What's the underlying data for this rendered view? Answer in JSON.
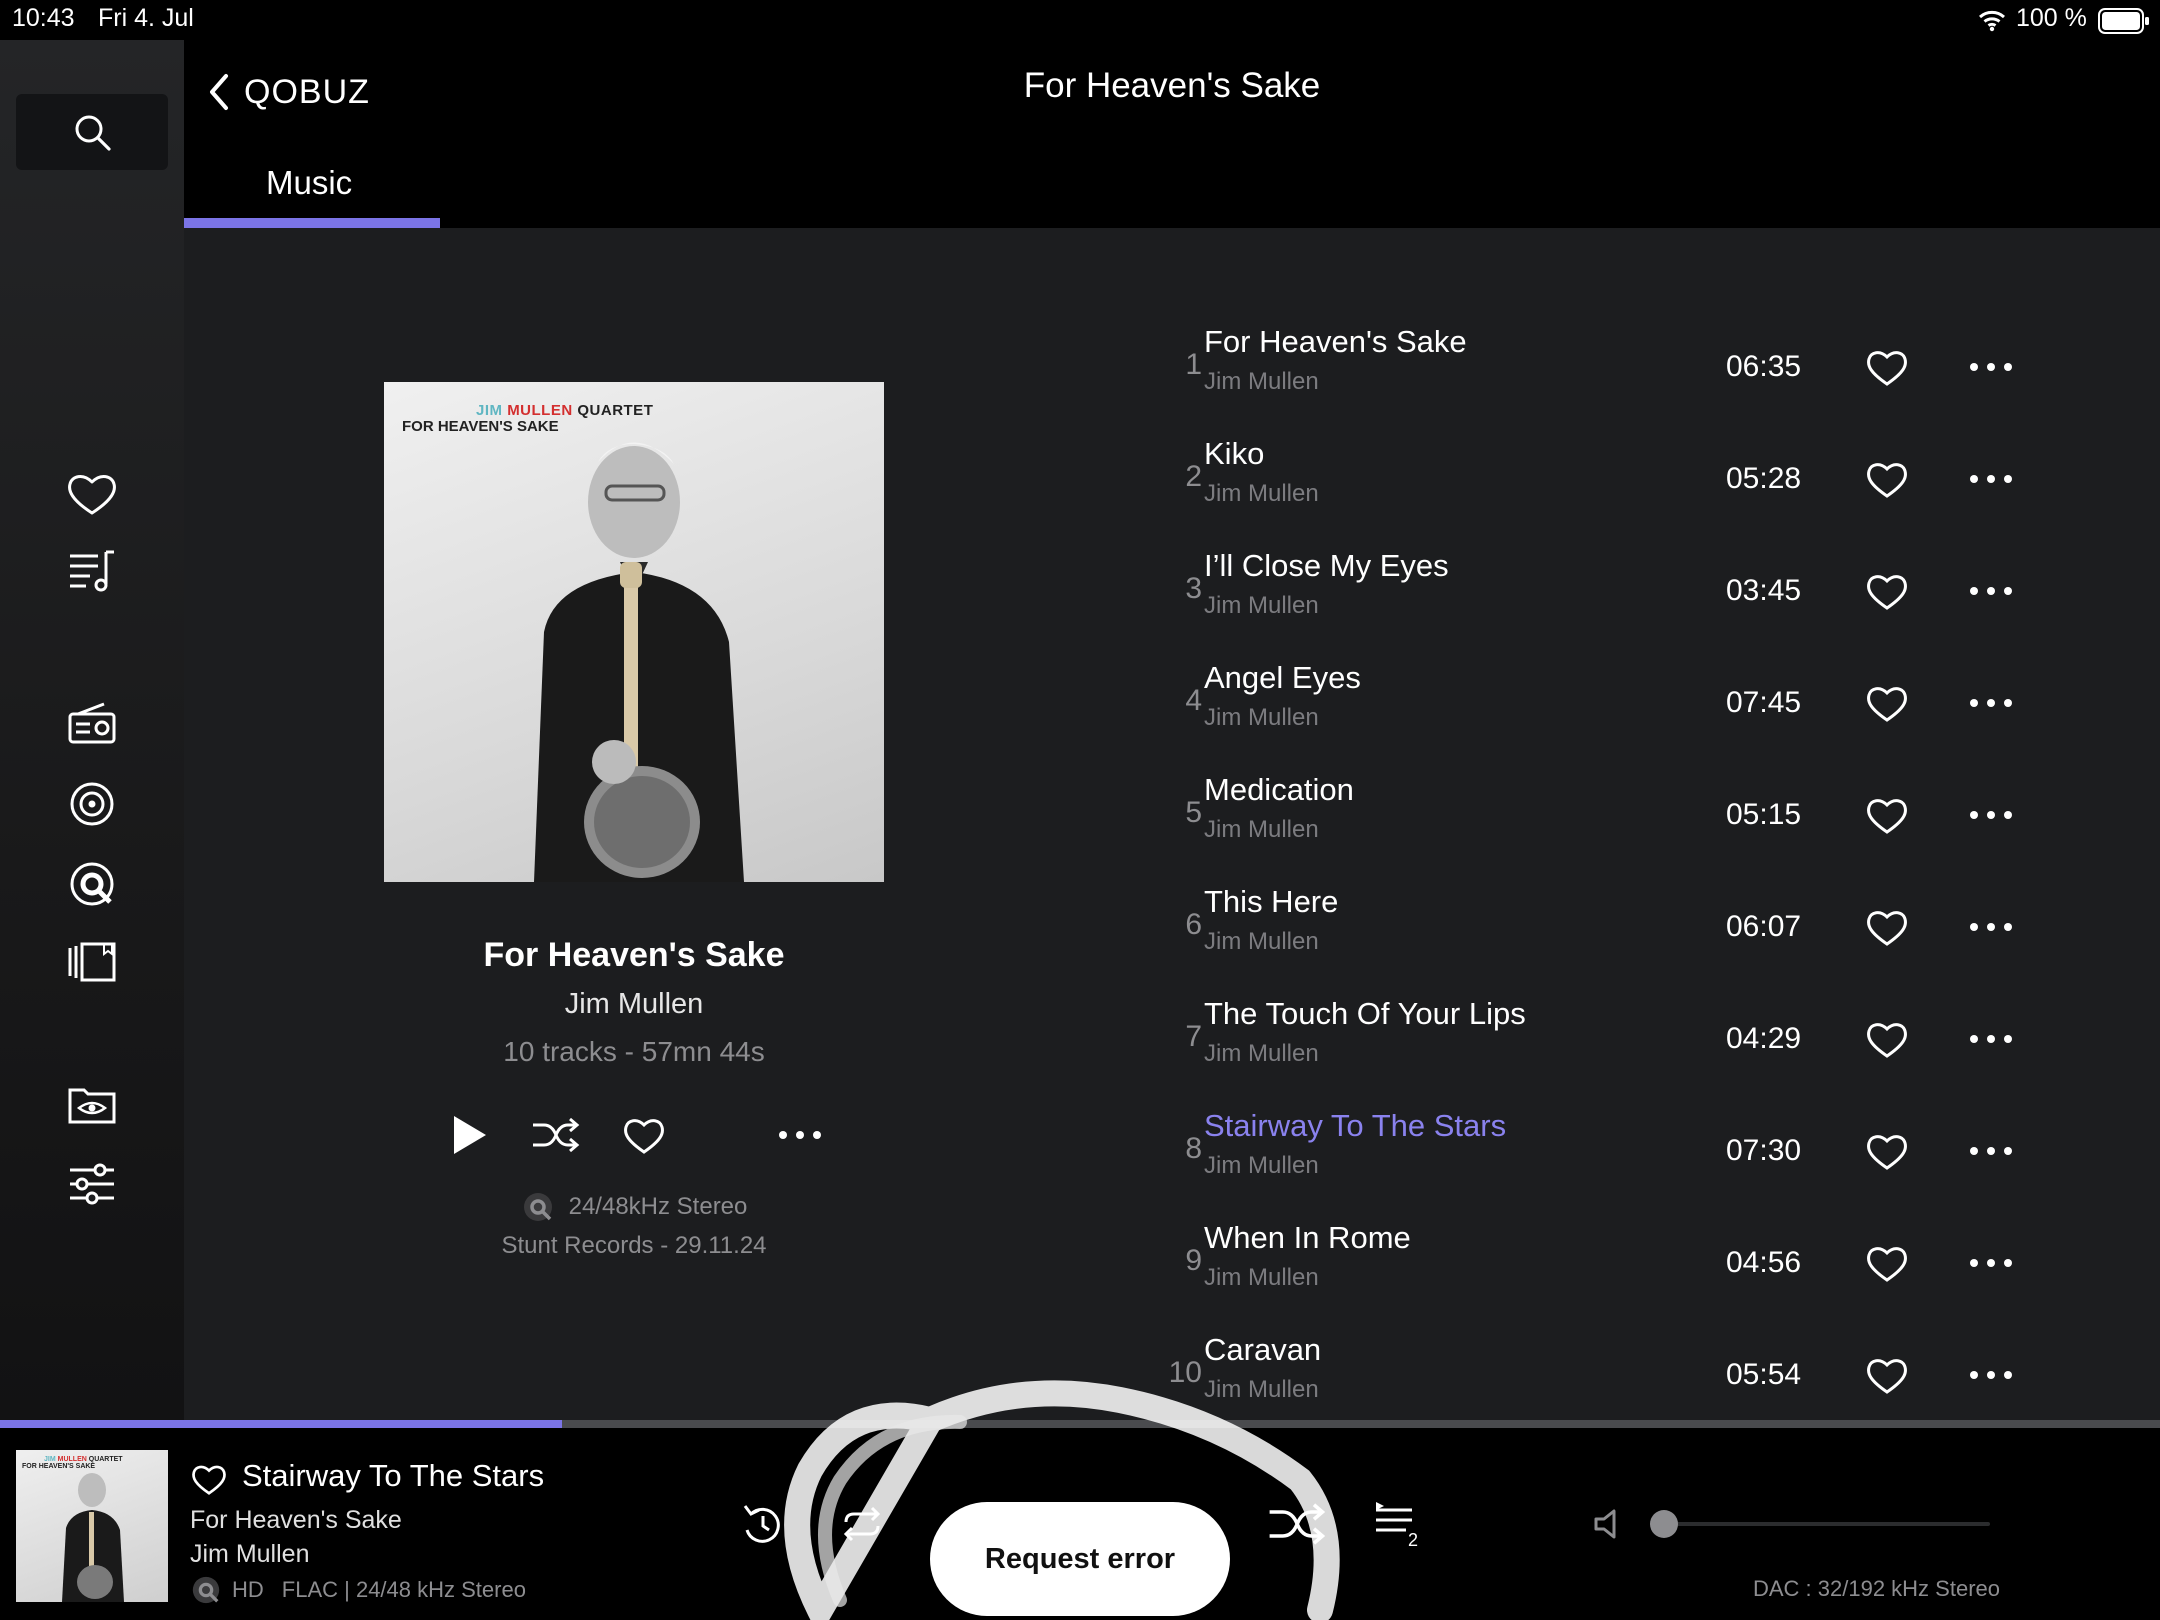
{
  "status": {
    "time": "10:43",
    "date": "Fri 4. Jul",
    "battery": "100 %"
  },
  "header": {
    "back_label": "QOBUZ",
    "title": "For Heaven's Sake",
    "tab": "Music"
  },
  "album": {
    "cover_text_line1_a": "JIM",
    "cover_text_line1_b": "MULLEN",
    "cover_text_line1_c": "QUARTET",
    "cover_text_line2": "FOR HEAVEN'S SAKE",
    "title": "For Heaven's Sake",
    "artist": "Jim Mullen",
    "info": "10 tracks - 57mn 44s",
    "quality": "24/48kHz Stereo",
    "label": "Stunt Records - 29.11.24"
  },
  "tracks": [
    {
      "num": "1",
      "title": "For Heaven's Sake",
      "artist": "Jim Mullen",
      "duration": "06:35"
    },
    {
      "num": "2",
      "title": "Kiko",
      "artist": "Jim Mullen",
      "duration": "05:28"
    },
    {
      "num": "3",
      "title": "I’ll Close My Eyes",
      "artist": "Jim Mullen",
      "duration": "03:45"
    },
    {
      "num": "4",
      "title": "Angel Eyes",
      "artist": "Jim Mullen",
      "duration": "07:45"
    },
    {
      "num": "5",
      "title": "Medication",
      "artist": "Jim Mullen",
      "duration": "05:15"
    },
    {
      "num": "6",
      "title": "This Here",
      "artist": "Jim Mullen",
      "duration": "06:07"
    },
    {
      "num": "7",
      "title": "The Touch Of Your Lips",
      "artist": "Jim Mullen",
      "duration": "04:29"
    },
    {
      "num": "8",
      "title": "Stairway To The Stars",
      "artist": "Jim Mullen",
      "duration": "07:30",
      "active": true
    },
    {
      "num": "9",
      "title": "When In Rome",
      "artist": "Jim Mullen",
      "duration": "04:56"
    },
    {
      "num": "10",
      "title": "Caravan",
      "artist": "Jim Mullen",
      "duration": "05:54"
    }
  ],
  "player": {
    "title": "Stairway To The Stars",
    "album": "For Heaven's Sake",
    "artist": "Jim Mullen",
    "hd": "HD",
    "format": "FLAC | 24/48 kHz Stereo",
    "queue_count": "2",
    "dac": "DAC : 32/192 kHz Stereo",
    "progress": 0.26,
    "volume": 0.0
  },
  "toast": "Request error",
  "colors": {
    "accent": "#7b74e6",
    "active_track": "#8a82ee",
    "muted": "#8d8d90"
  },
  "icons": [
    "search-icon",
    "heart-icon",
    "playlist-icon",
    "radio-icon",
    "target-icon",
    "qobuz-icon",
    "library-icon",
    "folder-eye-icon",
    "sliders-icon",
    "chevron-left-icon",
    "play-icon",
    "shuffle-icon",
    "more-icon",
    "replay-icon",
    "repeat-icon",
    "queue-icon",
    "volume-icon"
  ]
}
